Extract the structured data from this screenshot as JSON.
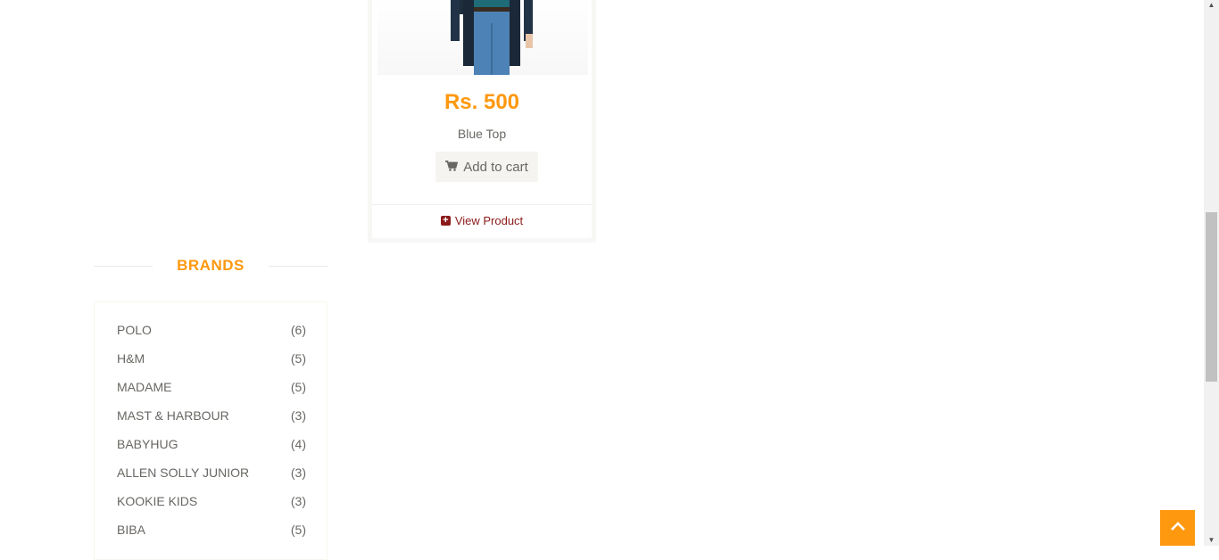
{
  "product": {
    "price": "Rs. 500",
    "name": "Blue Top",
    "add_to_cart_label": "Add to cart",
    "view_product_label": "View Product"
  },
  "brands": {
    "title": "BRANDS",
    "items": [
      {
        "name": "POLO",
        "count": "(6)"
      },
      {
        "name": "H&M",
        "count": "(5)"
      },
      {
        "name": "MADAME",
        "count": "(5)"
      },
      {
        "name": "MAST & HARBOUR",
        "count": "(3)"
      },
      {
        "name": "BABYHUG",
        "count": "(4)"
      },
      {
        "name": "ALLEN SOLLY JUNIOR",
        "count": "(3)"
      },
      {
        "name": "KOOKIE KIDS",
        "count": "(3)"
      },
      {
        "name": "BIBA",
        "count": "(5)"
      }
    ]
  },
  "colors": {
    "accent": "#fe980f",
    "text": "#696763",
    "link": "#8b1a1a"
  },
  "icons": {
    "cart": "shopping-cart-icon",
    "plus": "plus-square-icon",
    "scroll_top": "chevron-up-icon"
  }
}
